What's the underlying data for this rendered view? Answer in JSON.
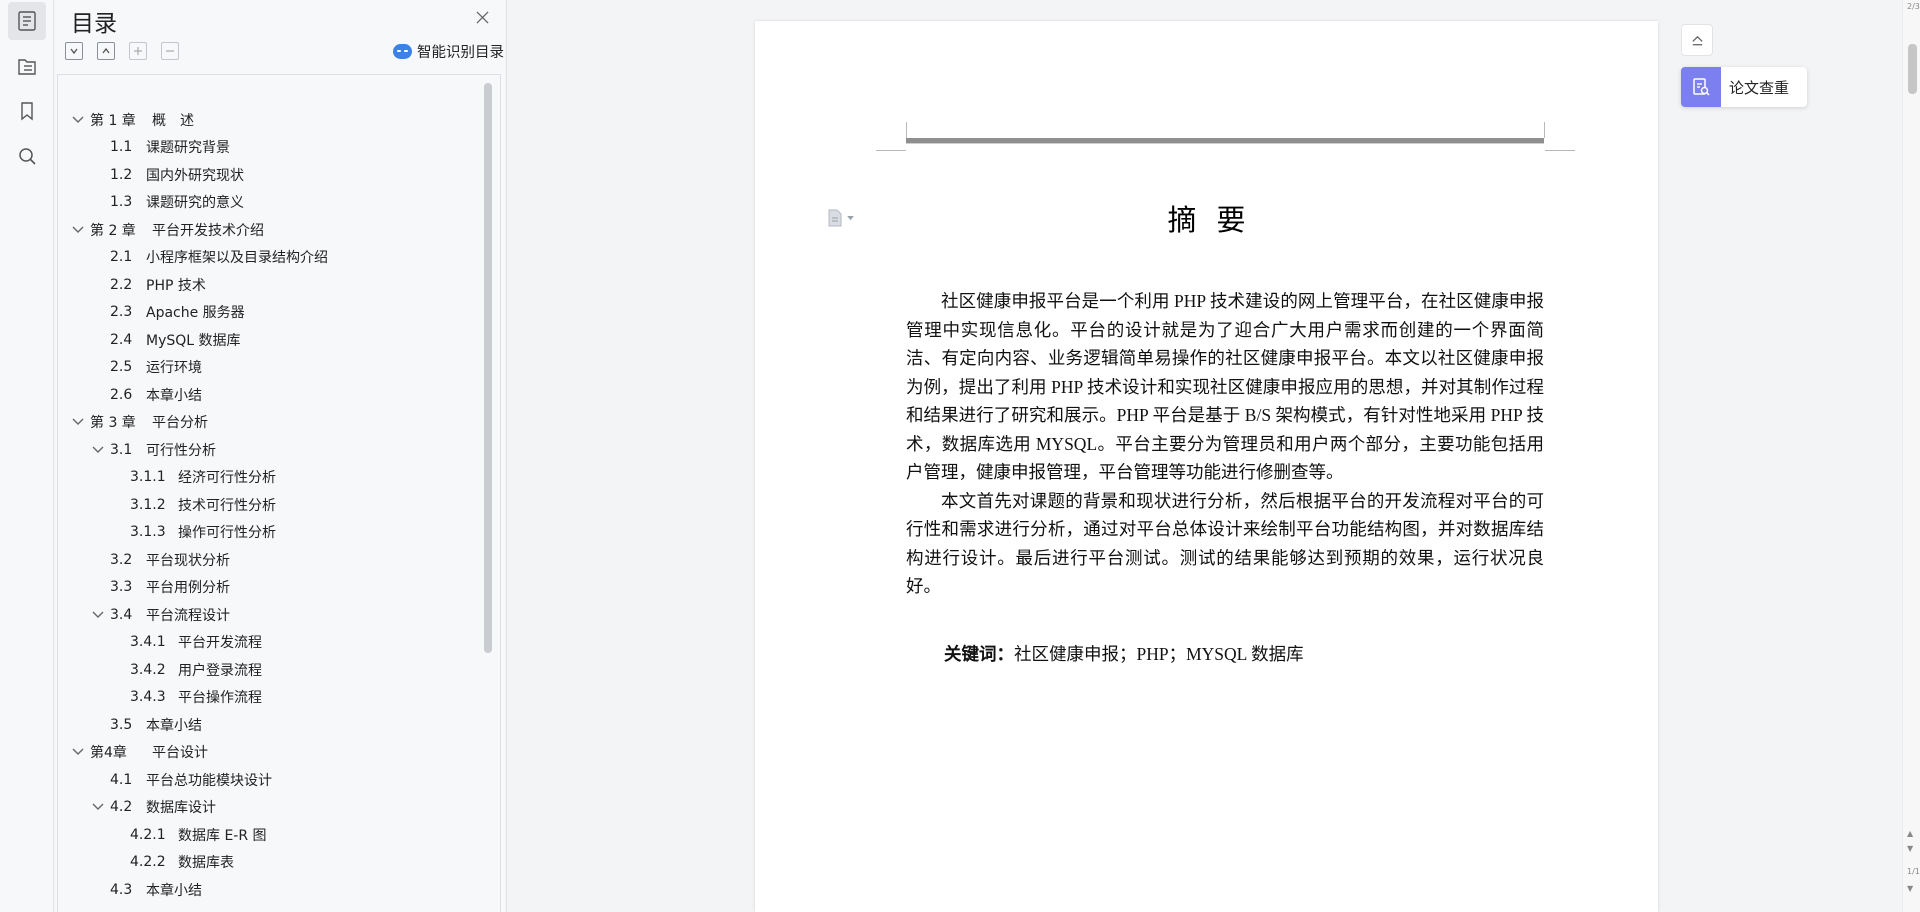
{
  "rail": {
    "items": [
      "toc-icon",
      "navigation-icon",
      "bookmark-icon",
      "search-icon"
    ]
  },
  "toc": {
    "title": "目录",
    "smart_label": "智能识别目录",
    "items": [
      {
        "level": 0,
        "expanded": true,
        "num": "第 1 章",
        "text": "概　述"
      },
      {
        "level": 1,
        "expanded": null,
        "num": "1.1",
        "text": "课题研究背景"
      },
      {
        "level": 1,
        "expanded": null,
        "num": "1.2",
        "text": "国内外研究现状"
      },
      {
        "level": 1,
        "expanded": null,
        "num": "1.3",
        "text": "课题研究的意义"
      },
      {
        "level": 0,
        "expanded": true,
        "num": "第 2 章",
        "text": "平台开发技术介绍"
      },
      {
        "level": 1,
        "expanded": null,
        "num": "2.1",
        "text": "小程序框架以及目录结构介绍"
      },
      {
        "level": 1,
        "expanded": null,
        "num": "2.2",
        "text": "PHP 技术"
      },
      {
        "level": 1,
        "expanded": null,
        "num": "2.3",
        "text": "Apache 服务器"
      },
      {
        "level": 1,
        "expanded": null,
        "num": "2.4",
        "text": "MySQL 数据库"
      },
      {
        "level": 1,
        "expanded": null,
        "num": "2.5",
        "text": "运行环境"
      },
      {
        "level": 1,
        "expanded": null,
        "num": "2.6",
        "text": "本章小结"
      },
      {
        "level": 0,
        "expanded": true,
        "num": "第 3 章",
        "text": "平台分析"
      },
      {
        "level": 1,
        "expanded": true,
        "num": "3.1",
        "text": "可行性分析"
      },
      {
        "level": 2,
        "expanded": null,
        "num": "3.1.1",
        "text": "经济可行性分析"
      },
      {
        "level": 2,
        "expanded": null,
        "num": "3.1.2",
        "text": "技术可行性分析"
      },
      {
        "level": 2,
        "expanded": null,
        "num": "3.1.3",
        "text": "操作可行性分析"
      },
      {
        "level": 1,
        "expanded": null,
        "num": "3.2",
        "text": "平台现状分析"
      },
      {
        "level": 1,
        "expanded": null,
        "num": "3.3",
        "text": "平台用例分析"
      },
      {
        "level": 1,
        "expanded": true,
        "num": "3.4",
        "text": "平台流程设计"
      },
      {
        "level": 2,
        "expanded": null,
        "num": "3.4.1",
        "text": "平台开发流程"
      },
      {
        "level": 2,
        "expanded": null,
        "num": "3.4.2",
        "text": "用户登录流程"
      },
      {
        "level": 2,
        "expanded": null,
        "num": "3.4.3",
        "text": "平台操作流程"
      },
      {
        "level": 1,
        "expanded": null,
        "num": "3.5",
        "text": "本章小结"
      },
      {
        "level": 0,
        "expanded": true,
        "num": "第4章",
        "text": "平台设计"
      },
      {
        "level": 1,
        "expanded": null,
        "num": "4.1",
        "text": "平台总功能模块设计"
      },
      {
        "level": 1,
        "expanded": true,
        "num": "4.2",
        "text": "数据库设计"
      },
      {
        "level": 2,
        "expanded": null,
        "num": "4.2.1",
        "text": "数据库 E-R 图"
      },
      {
        "level": 2,
        "expanded": null,
        "num": "4.2.2",
        "text": "数据库表"
      },
      {
        "level": 1,
        "expanded": null,
        "num": "4.3",
        "text": "本章小结"
      }
    ]
  },
  "document": {
    "title": "摘要",
    "paragraphs": [
      "社区健康申报平台是一个利用 PHP 技术建设的网上管理平台，在社区健康申报管理中实现信息化。平台的设计就是为了迎合广大用户需求而创建的一个界面简洁、有定向内容、业务逻辑简单易操作的社区健康申报平台。本文以社区健康申报为例，提出了利用 PHP 技术设计和实现社区健康申报应用的思想，并对其制作过程和结果进行了研究和展示。PHP 平台是基于 B/S 架构模式，有针对性地采用 PHP 技术，数据库选用 MYSQL。平台主要分为管理员和用户两个部分，主要功能包括用户管理，健康申报管理，平台管理等功能进行修删查等。",
      "本文首先对课题的背景和现状进行分析，然后根据平台的开发流程对平台的可行性和需求进行分析，通过对平台总体设计来绘制平台功能结构图，并对数据库结构进行设计。最后进行平台测试。测试的结果能够达到预期的效果，运行状况良好。"
    ],
    "keywords_label": "关键词：",
    "keywords": "社区健康申报；PHP；MYSQL 数据库"
  },
  "float": {
    "check_label": "论文查重"
  },
  "scrollbar": {
    "top_label": "2/3",
    "bottom_label": "1/1"
  },
  "colors": {
    "accent": "#7b7ff0",
    "smart_icon": "#3b82e8"
  }
}
